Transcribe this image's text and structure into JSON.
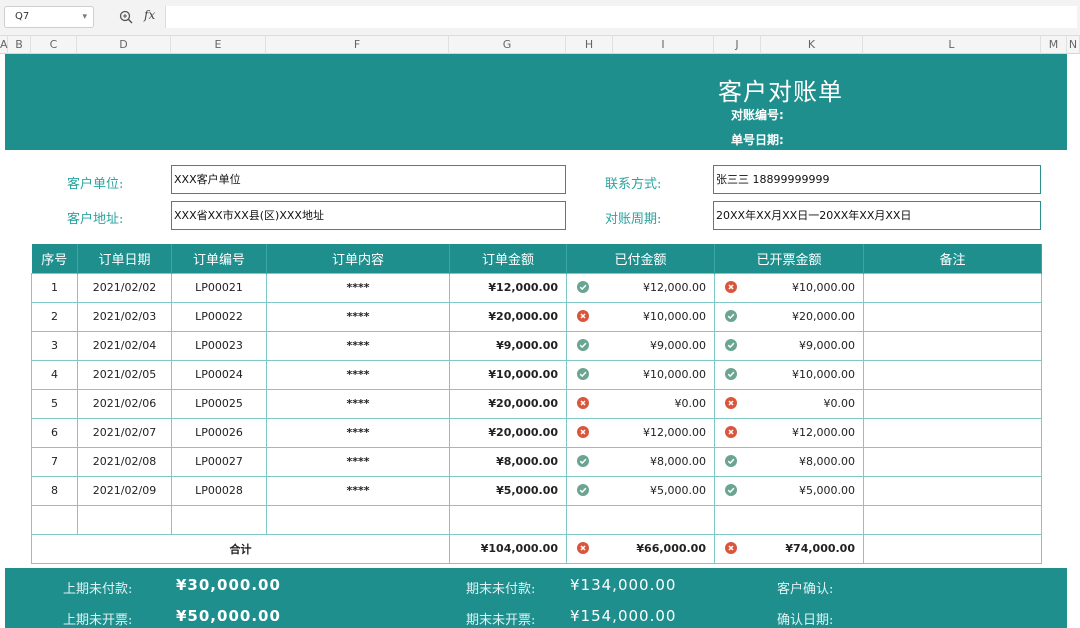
{
  "formula_bar": {
    "cell_ref": "Q7",
    "fx_label": "fx",
    "formula": ""
  },
  "columns": [
    "A",
    "B",
    "C",
    "D",
    "E",
    "F",
    "G",
    "H",
    "I",
    "J",
    "K",
    "L",
    "M",
    "N"
  ],
  "banner": {
    "title": "客户对账单",
    "ref_no_label": "对账编号:",
    "date_label": "单号日期:"
  },
  "customer": {
    "unit_label": "客户单位:",
    "unit_value": "XXX客户单位",
    "address_label": "客户地址:",
    "address_value": "XXX省XX市XX县(区)XXX地址",
    "contact_label": "联系方式:",
    "contact_value": "张三三    18899999999",
    "period_label": "对账周期:",
    "period_value": "20XX年XX月XX日一20XX年XX月XX日"
  },
  "table": {
    "headers": [
      "序号",
      "订单日期",
      "订单编号",
      "订单内容",
      "订单金额",
      "已付金额",
      "已开票金额",
      "备注"
    ],
    "rows": [
      {
        "no": "1",
        "date": "2021/02/02",
        "order_id": "LP00021",
        "content": "****",
        "amount": "¥12,000.00",
        "paid_status": "ok",
        "paid": "¥12,000.00",
        "invoiced_status": "no",
        "invoiced": "¥10,000.00",
        "note": ""
      },
      {
        "no": "2",
        "date": "2021/02/03",
        "order_id": "LP00022",
        "content": "****",
        "amount": "¥20,000.00",
        "paid_status": "no",
        "paid": "¥10,000.00",
        "invoiced_status": "ok",
        "invoiced": "¥20,000.00",
        "note": ""
      },
      {
        "no": "3",
        "date": "2021/02/04",
        "order_id": "LP00023",
        "content": "****",
        "amount": "¥9,000.00",
        "paid_status": "ok",
        "paid": "¥9,000.00",
        "invoiced_status": "ok",
        "invoiced": "¥9,000.00",
        "note": ""
      },
      {
        "no": "4",
        "date": "2021/02/05",
        "order_id": "LP00024",
        "content": "****",
        "amount": "¥10,000.00",
        "paid_status": "ok",
        "paid": "¥10,000.00",
        "invoiced_status": "ok",
        "invoiced": "¥10,000.00",
        "note": ""
      },
      {
        "no": "5",
        "date": "2021/02/06",
        "order_id": "LP00025",
        "content": "****",
        "amount": "¥20,000.00",
        "paid_status": "no",
        "paid": "¥0.00",
        "invoiced_status": "no",
        "invoiced": "¥0.00",
        "note": ""
      },
      {
        "no": "6",
        "date": "2021/02/07",
        "order_id": "LP00026",
        "content": "****",
        "amount": "¥20,000.00",
        "paid_status": "no",
        "paid": "¥12,000.00",
        "invoiced_status": "no",
        "invoiced": "¥12,000.00",
        "note": ""
      },
      {
        "no": "7",
        "date": "2021/02/08",
        "order_id": "LP00027",
        "content": "****",
        "amount": "¥8,000.00",
        "paid_status": "ok",
        "paid": "¥8,000.00",
        "invoiced_status": "ok",
        "invoiced": "¥8,000.00",
        "note": ""
      },
      {
        "no": "8",
        "date": "2021/02/09",
        "order_id": "LP00028",
        "content": "****",
        "amount": "¥5,000.00",
        "paid_status": "ok",
        "paid": "¥5,000.00",
        "invoiced_status": "ok",
        "invoiced": "¥5,000.00",
        "note": ""
      }
    ],
    "total": {
      "label": "合计",
      "amount": "¥104,000.00",
      "paid_status": "no",
      "paid": "¥66,000.00",
      "invoiced_status": "no",
      "invoiced": "¥74,000.00"
    }
  },
  "footer": {
    "prev_unpaid_label": "上期未付款:",
    "prev_unpaid_value": "¥30,000.00",
    "prev_uninvoiced_label": "上期未开票:",
    "prev_uninvoiced_value": "¥50,000.00",
    "end_unpaid_label": "期末未付款:",
    "end_unpaid_value": "¥134,000.00",
    "end_uninvoiced_label": "期末未开票:",
    "end_uninvoiced_value": "¥154,000.00",
    "confirm_label": "客户确认:",
    "confirm_date_label": "确认日期:"
  }
}
